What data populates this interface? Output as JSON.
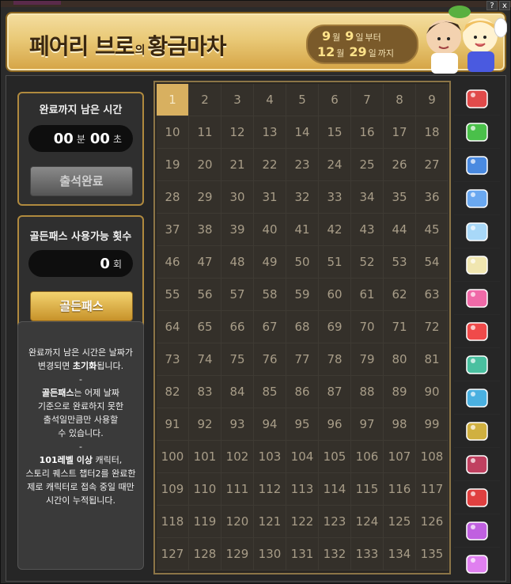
{
  "window": {
    "help_label": "?",
    "close_label": "x"
  },
  "banner": {
    "title_part1": "페어리 브로",
    "title_particle": "의",
    "title_part2": "황금마차",
    "start_month": "9",
    "start_day": "9",
    "end_month": "12",
    "end_day": "29",
    "month_unit": "월",
    "day_unit": "일",
    "from_label": "부터",
    "to_label": "까지"
  },
  "timer": {
    "label": "완료까지 남은 시간",
    "minutes": "00",
    "minutes_unit": "분",
    "seconds": "00",
    "seconds_unit": "초",
    "button_label": "출석완료"
  },
  "golden_pass": {
    "label": "골든패스 사용가능 횟수",
    "count": "0",
    "count_unit": "회",
    "button_label": "골든패스"
  },
  "info": {
    "line1": "완료까지 남은 시간은 날짜가",
    "line2a": "변경되면 ",
    "line2b": "초기화",
    "line2c": "됩니다.",
    "sep1": "-",
    "line3a": "골든패스",
    "line3b": "는 어제 날짜",
    "line4": "기준으로 완료하지 못한",
    "line5": "출석일만큼만 사용할",
    "line6": "수 있습니다.",
    "sep2": "-",
    "line7a": "101레벨 이상",
    "line7b": " 캐릭터,",
    "line8": "스토리 퀘스트 챕터2를 완료한",
    "line9": "제로 캐릭터로 접속 중일 때만",
    "line10": "시간이 누적됩니다."
  },
  "grid": {
    "current_day": 1,
    "days": [
      "1",
      "2",
      "3",
      "4",
      "5",
      "6",
      "7",
      "8",
      "9",
      "10",
      "11",
      "12",
      "13",
      "14",
      "15",
      "16",
      "17",
      "18",
      "19",
      "20",
      "21",
      "22",
      "23",
      "24",
      "25",
      "26",
      "27",
      "28",
      "29",
      "30",
      "31",
      "32",
      "33",
      "34",
      "35",
      "36",
      "37",
      "38",
      "39",
      "40",
      "41",
      "42",
      "43",
      "44",
      "45",
      "46",
      "47",
      "48",
      "49",
      "50",
      "51",
      "52",
      "53",
      "54",
      "55",
      "56",
      "57",
      "58",
      "59",
      "60",
      "61",
      "62",
      "63",
      "64",
      "65",
      "66",
      "67",
      "68",
      "69",
      "70",
      "71",
      "72",
      "73",
      "74",
      "75",
      "76",
      "77",
      "78",
      "79",
      "80",
      "81",
      "82",
      "83",
      "84",
      "85",
      "86",
      "87",
      "88",
      "89",
      "90",
      "91",
      "92",
      "93",
      "94",
      "95",
      "96",
      "97",
      "98",
      "99",
      "100",
      "101",
      "102",
      "103",
      "104",
      "105",
      "106",
      "107",
      "108",
      "109",
      "110",
      "111",
      "112",
      "113",
      "114",
      "115",
      "116",
      "117",
      "118",
      "119",
      "120",
      "121",
      "122",
      "123",
      "124",
      "125",
      "126",
      "127",
      "128",
      "129",
      "130",
      "131",
      "132",
      "133",
      "134",
      "135"
    ]
  },
  "rewards": [
    {
      "icon": "red-heart-potion-icon",
      "color": "#e04a4a"
    },
    {
      "icon": "green-heart-potion-icon",
      "color": "#4ac04a"
    },
    {
      "icon": "blue-ticket-icon",
      "color": "#4a8ae0"
    },
    {
      "icon": "blue-wings-icon",
      "color": "#6aa8f0"
    },
    {
      "icon": "ice-frame-icon",
      "color": "#a8d8f8"
    },
    {
      "icon": "pet-egg-icon",
      "color": "#f0e6b0"
    },
    {
      "icon": "pink-ticket-icon",
      "color": "#f06aa8"
    },
    {
      "icon": "potion-bottle-icon",
      "color": "#f04a4a"
    },
    {
      "icon": "green-chest-icon",
      "color": "#4ac0a0"
    },
    {
      "icon": "blue-coupon-icon",
      "color": "#4ab0e0"
    },
    {
      "icon": "gold-chest-icon",
      "color": "#d0b040"
    },
    {
      "icon": "dark-ticket-icon",
      "color": "#c04060"
    },
    {
      "icon": "red-giftbox-icon",
      "color": "#e04040"
    },
    {
      "icon": "treasure-box-icon",
      "color": "#c060e0"
    },
    {
      "icon": "magic-wand-icon",
      "color": "#e080f0"
    }
  ]
}
